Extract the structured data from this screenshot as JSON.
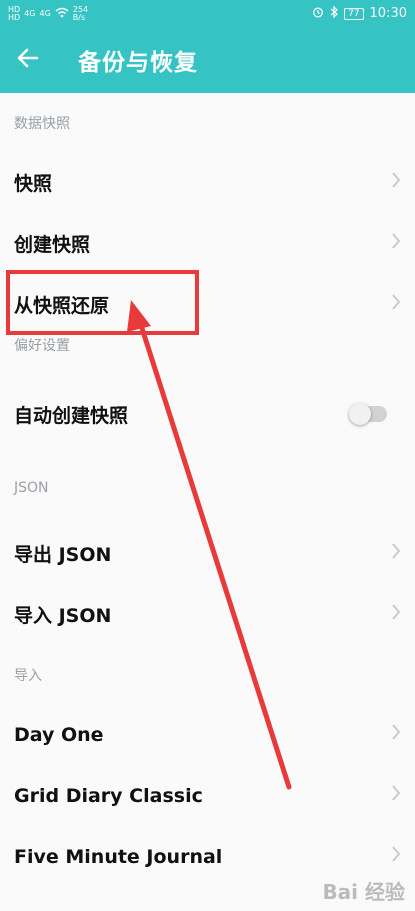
{
  "status_bar": {
    "hd1": "HD",
    "hd2": "HD",
    "signal1": "4G",
    "signal2": "4G",
    "speed_value": "254",
    "speed_unit": "B/s",
    "battery": "77",
    "time": "10:30"
  },
  "header": {
    "back_icon": "arrow-left-icon",
    "title": "备份与恢复"
  },
  "sections": [
    {
      "header": "数据快照",
      "items": [
        "快照",
        "创建快照",
        "从快照还原"
      ]
    },
    {
      "header": "偏好设置",
      "items": [
        "自动创建快照"
      ]
    },
    {
      "header": "JSON",
      "items": [
        "导出 JSON",
        "导入 JSON"
      ]
    },
    {
      "header": "导入",
      "items": [
        "Day One",
        "Grid Diary Classic",
        "Five Minute Journal"
      ]
    }
  ],
  "toggle": {
    "auto_snapshot_enabled": false
  },
  "annotation": {
    "highlight_color": "#e83a3a"
  },
  "colors": {
    "accent": "#35c4c3",
    "text": "#111111",
    "section": "#9aa0a6"
  },
  "watermark": "Bai 经验"
}
